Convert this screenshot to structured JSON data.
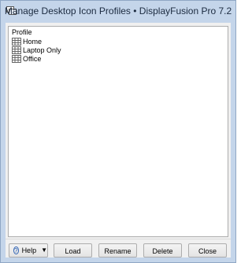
{
  "window": {
    "title": "Manage Desktop Icon Profiles • DisplayFusion Pro 7.2"
  },
  "list": {
    "header": "Profile",
    "items": [
      {
        "label": "Home",
        "icon": "profile-grid-icon"
      },
      {
        "label": "Laptop Only",
        "icon": "profile-grid-icon"
      },
      {
        "label": "Office",
        "icon": "profile-grid-icon"
      }
    ]
  },
  "buttons": {
    "help": "Help",
    "load": "Load",
    "rename": "Rename",
    "delete": "Delete",
    "close": "Close"
  },
  "colors": {
    "frame": "#c4d5ea",
    "client": "#f0f0f0",
    "help_icon": "#2e62b3"
  }
}
